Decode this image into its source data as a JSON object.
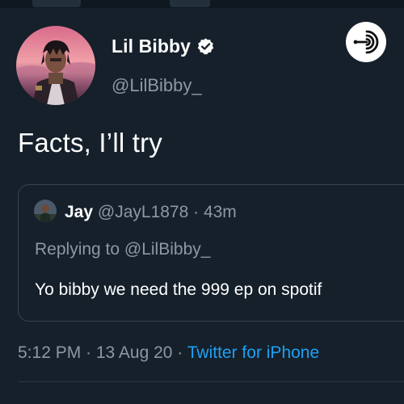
{
  "tweet": {
    "display_name": "Lil Bibby",
    "handle": "@LilBibby_",
    "text": "Facts, I’ll try",
    "timestamp": "5:12 PM · 13 Aug 20 · ",
    "source": "Twitter for iPhone"
  },
  "quote": {
    "name": "Jay",
    "meta": "@JayL1878 · 43m",
    "replying": "Replying to @LilBibby_",
    "text": "Yo bibby we need the 999 ep on spotif"
  },
  "icons": {
    "verified": "verified-badge-icon",
    "podcast": "podcast-icon"
  },
  "colors": {
    "background": "#15202b",
    "secondary_text": "#8b98a5",
    "link": "#1da1f2",
    "border": "#38444d"
  }
}
